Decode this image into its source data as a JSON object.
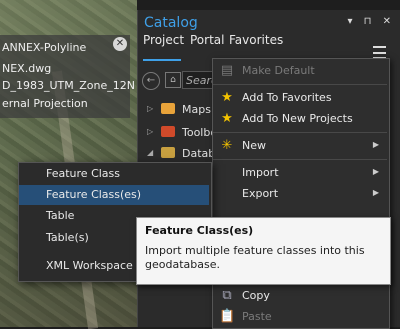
{
  "map": {
    "popup_lines": [
      "ANNEX-Polyline",
      "NEX.dwg",
      "D_1983_UTM_Zone_12N",
      "ernal Projection"
    ],
    "close_icon": "close-icon"
  },
  "catalog": {
    "title": "Catalog",
    "controls": "▾ ⊓ ✕",
    "tabs": [
      "Project",
      "Portal",
      "Favorites"
    ],
    "search_placeholder": "Search",
    "tree": [
      {
        "label": "Maps",
        "icon": "maps-folder-icon",
        "color": "#e8a33a"
      },
      {
        "label": "Toolboxes",
        "icon": "toolbox-icon",
        "color": "#d04a2a"
      },
      {
        "label": "Databases",
        "icon": "database-icon",
        "color": "#c8a040"
      }
    ]
  },
  "context_menu": {
    "items": [
      {
        "label": "Make Default",
        "icon": "database-icon",
        "disabled": true,
        "submenu": false
      },
      {
        "label": "Add To Favorites",
        "icon": "star-icon",
        "disabled": false,
        "submenu": false
      },
      {
        "label": "Add To New Projects",
        "icon": "star-icon",
        "disabled": false,
        "submenu": false
      },
      {
        "label": "New",
        "icon": "new-icon",
        "disabled": false,
        "submenu": true
      },
      {
        "label": "Import",
        "icon": "",
        "disabled": false,
        "submenu": true
      },
      {
        "label": "Export",
        "icon": "",
        "disabled": false,
        "submenu": true
      },
      {
        "label": "Copy",
        "icon": "copy-icon",
        "disabled": false,
        "submenu": false
      },
      {
        "label": "Paste",
        "icon": "paste-icon",
        "disabled": true,
        "submenu": false
      }
    ]
  },
  "import_submenu": {
    "items": [
      "Feature Class",
      "Feature Class(es)",
      "Table",
      "Table(s)",
      "XML Workspace Do"
    ],
    "highlighted_index": 1
  },
  "tooltip": {
    "title": "Feature Class(es)",
    "body": "Import multiple feature classes into this geodatabase."
  },
  "colors": {
    "accent": "#3fa0e8",
    "highlight": "#264f78",
    "star": "#f2c200"
  }
}
